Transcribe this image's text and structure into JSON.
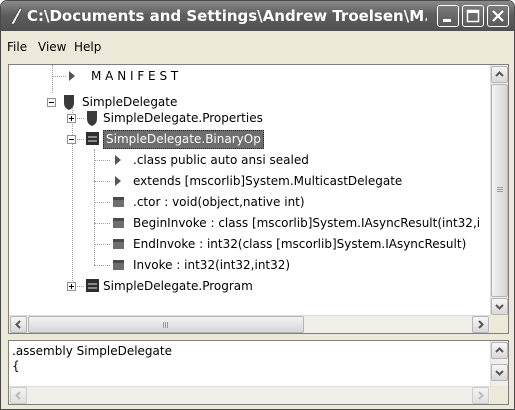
{
  "window": {
    "title": "C:\\Documents and Settings\\Andrew Troelsen\\M..."
  },
  "menu": [
    {
      "label": "File"
    },
    {
      "label": "View"
    },
    {
      "label": "Help"
    }
  ],
  "tree": {
    "nodes": [
      {
        "label": "M A N I F E S T",
        "icon": "manifest-arrow-icon"
      },
      {
        "label": "SimpleDelegate",
        "icon": "assembly-shield-icon",
        "expander": "minus"
      },
      {
        "label": "SimpleDelegate.Properties",
        "icon": "namespace-shield-icon",
        "expander": "plus"
      },
      {
        "label": "SimpleDelegate.BinaryOp",
        "icon": "class-icon",
        "expander": "minus",
        "selected": true
      },
      {
        "label": ".class public auto ansi sealed",
        "icon": "info-arrow-icon"
      },
      {
        "label": "extends [mscorlib]System.MulticastDelegate",
        "icon": "info-arrow-icon"
      },
      {
        "label": ".ctor : void(object,native int)",
        "icon": "method-icon"
      },
      {
        "label": "BeginInvoke : class [mscorlib]System.IAsyncResult(int32,i",
        "icon": "method-icon"
      },
      {
        "label": "EndInvoke : int32(class [mscorlib]System.IAsyncResult)",
        "icon": "method-icon"
      },
      {
        "label": "Invoke : int32(int32,int32)",
        "icon": "method-icon"
      },
      {
        "label": "SimpleDelegate.Program",
        "icon": "class-icon",
        "expander": "plus"
      }
    ]
  },
  "code_pane": {
    "lines": [
      ".assembly SimpleDelegate",
      "{"
    ]
  },
  "scrollbars": {
    "tree_vertical_position": 0,
    "tree_horizontal_position": 0
  },
  "colors": {
    "selection": "#6e6e6e",
    "titlebar": "#5e5e5e",
    "window_bg": "#ece9d8"
  }
}
